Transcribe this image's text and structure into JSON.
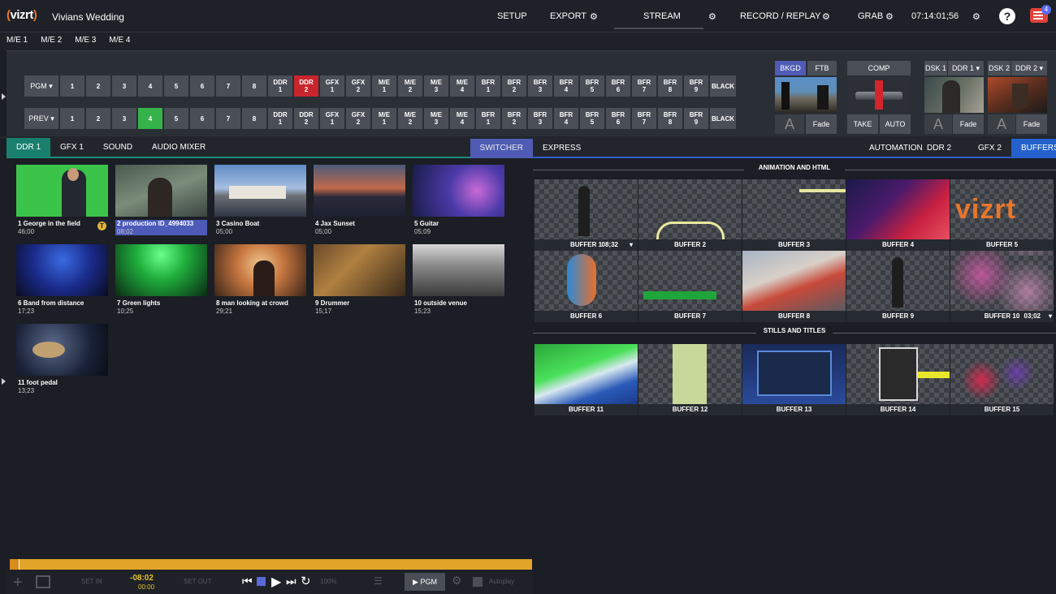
{
  "app": {
    "logo": "vizrt",
    "project": "Vivians Wedding"
  },
  "topbar": {
    "setup": "SETUP",
    "export": "EXPORT",
    "stream": "STREAM",
    "record": "RECORD / REPLAY",
    "grab": "GRAB",
    "clock": "07:14:01;56",
    "help": "?",
    "notifications": "4"
  },
  "me_tabs": [
    "M/E 1",
    "M/E 2",
    "M/E 3",
    "M/E 4"
  ],
  "switcher": {
    "pgm_label": "PGM ▾",
    "prev_label": "PREV ▾",
    "pgm_buttons": [
      "1",
      "2",
      "3",
      "4",
      "5",
      "6",
      "7",
      "8",
      "DDR\n1",
      "DDR\n2",
      "GFX\n1",
      "GFX\n2",
      "M/E\n1",
      "M/E\n2",
      "M/E\n3",
      "M/E\n4",
      "BFR\n1",
      "BFR\n2",
      "BFR\n3",
      "BFR\n4",
      "BFR\n5",
      "BFR\n6",
      "BFR\n7",
      "BFR\n8",
      "BFR\n9",
      "BLACK"
    ],
    "prev_buttons": [
      "1",
      "2",
      "3",
      "4",
      "5",
      "6",
      "7",
      "8",
      "DDR\n1",
      "DDR\n2",
      "GFX\n1",
      "GFX\n2",
      "M/E\n1",
      "M/E\n2",
      "M/E\n3",
      "M/E\n4",
      "BFR\n1",
      "BFR\n2",
      "BFR\n3",
      "BFR\n4",
      "BFR\n5",
      "BFR\n6",
      "BFR\n7",
      "BFR\n8",
      "BFR\n9",
      "BLACK"
    ],
    "pgm_active": "DDR\n2",
    "prev_active": "4"
  },
  "mix": {
    "bkgd": "BKGD",
    "ftb": "FTB",
    "comp": "COMP",
    "fade": "Fade",
    "take": "TAKE",
    "auto": "AUTO",
    "dsk1": "DSK 1",
    "dsk1_src": "DDR 1 ▾",
    "dsk2": "DSK 2",
    "dsk2_src": "DDR 2 ▾",
    "dsk1_fade": "Fade",
    "dsk2_fade": "Fade"
  },
  "left_tabs": [
    "DDR 1",
    "GFX 1",
    "SOUND",
    "AUDIO MIXER"
  ],
  "switcher_tab": "SWITCHER",
  "right_tabs": {
    "express": "EXPRESS",
    "automation": "AUTOMATION",
    "ddr2": "DDR 2",
    "gfx2": "GFX 2",
    "buffers": "BUFFERS"
  },
  "clips": [
    {
      "name": "1 George in the field",
      "dur": "46;00"
    },
    {
      "name": "2 production ID_4994033",
      "dur": "08;02"
    },
    {
      "name": "3 Casino Boat",
      "dur": "05;00"
    },
    {
      "name": "4 Jax Sunset",
      "dur": "05;00"
    },
    {
      "name": "5 Guitar",
      "dur": "05;09"
    },
    {
      "name": "6 Band from distance",
      "dur": "17;23"
    },
    {
      "name": "7 Green lights",
      "dur": "10;25"
    },
    {
      "name": "8 man looking at crowd",
      "dur": "29;21"
    },
    {
      "name": "9 Drummer",
      "dur": "15;17"
    },
    {
      "name": "10 outside venue",
      "dur": "15;23"
    },
    {
      "name": "11 foot pedal",
      "dur": "13;23"
    }
  ],
  "transport": {
    "set_in": "SET IN",
    "set_out": "SET OUT",
    "time": "-08:02",
    "time2": "00:00",
    "speed": "100%",
    "pgm": "▶ PGM",
    "autoplay": "Autoplay"
  },
  "buffers": {
    "section1": "ANIMATION AND HTML",
    "section2": "STILLS AND TITLES",
    "items": [
      "BUFFER 1",
      "BUFFER 2",
      "BUFFER 3",
      "BUFFER 4",
      "BUFFER 5",
      "BUFFER 6",
      "BUFFER 7",
      "BUFFER 8",
      "BUFFER 9",
      "BUFFER 10",
      "BUFFER 11",
      "BUFFER 12",
      "BUFFER 13",
      "BUFFER 14",
      "BUFFER 15"
    ],
    "b1_time": "08;32",
    "b10_time": "03;02",
    "b5_logo": "vizrt"
  }
}
